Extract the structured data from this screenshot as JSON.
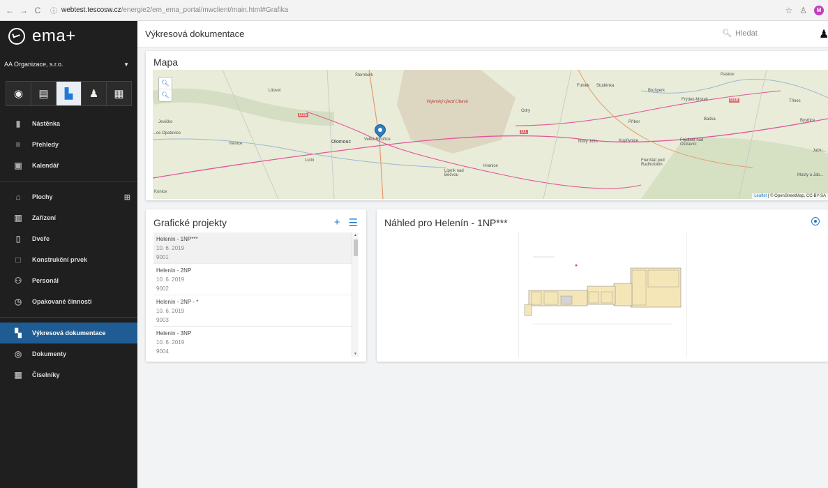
{
  "browser": {
    "url_host": "webtest.tescosw.cz",
    "url_path": "/energie2/em_ema_portal/mwclient/main.html#Grafika",
    "profile_initial": "M"
  },
  "sidebar": {
    "logo": "ema+",
    "org_name": "AA Organizace, s.r.o.",
    "items": [
      {
        "label": "Nástěnka",
        "icon": "bar-chart-icon"
      },
      {
        "label": "Přehledy",
        "icon": "list-icon"
      },
      {
        "label": "Kalendář",
        "icon": "calendar-icon"
      },
      {
        "label": "Plochy",
        "icon": "building-icon"
      },
      {
        "label": "Zařízení",
        "icon": "device-icon"
      },
      {
        "label": "Dveře",
        "icon": "door-icon"
      },
      {
        "label": "Konstrukční prvek",
        "icon": "square-icon"
      },
      {
        "label": "Personál",
        "icon": "people-icon"
      },
      {
        "label": "Opakované činnosti",
        "icon": "timer-icon"
      },
      {
        "label": "Výkresová dokumentace",
        "icon": "map-icon"
      },
      {
        "label": "Dokumenty",
        "icon": "eye-icon"
      },
      {
        "label": "Číselníky",
        "icon": "grid-icon"
      }
    ]
  },
  "header": {
    "title": "Výkresová dokumentace",
    "search_placeholder": "Hledat"
  },
  "map": {
    "title": "Mapa",
    "attribution_link": "Leaflet",
    "attribution_text": " | © OpenStreetMap, CC-BY-SA",
    "labels": {
      "sternberk": "Šternberk",
      "litovel": "Litovel",
      "vojensky": "Vojenský újezd Libavá",
      "olomouc": "Olomouc",
      "velka_bystrice": "Velká Bystřice",
      "kenice": "Kenice",
      "lutin": "Lutín",
      "lipnik": "Lipník nad Bečvou",
      "hranice": "Hranice",
      "odry": "Odry",
      "fulnek": "Fulnek",
      "studenka": "Studénka",
      "brusperk": "Brušperk",
      "frydek": "Frýdek-Místek",
      "novy_jicin": "Nový Jičín",
      "koprivnice": "Kopřivnice",
      "frenstat": "Frenštát pod Radhoštěm",
      "frydlant": "Frýdlant nad Ostravicí",
      "baska": "Baška",
      "pribor": "Příbor",
      "trinec": "Třinec",
      "bystrice": "Bystřice",
      "jablunkov": "Jablu...",
      "mosty": "Mosty u Jab...",
      "prostejov": "...ce Opatovice",
      "jevicko": "Jevíčko",
      "konice": "Konice",
      "paskov": "Paskov",
      "d35": "D35",
      "d1": "D1",
      "d48": "D48"
    }
  },
  "projects": {
    "title": "Grafické projekty",
    "items": [
      {
        "name": "Helenín - 1NP***",
        "date": "10. 6. 2019",
        "code": "9001"
      },
      {
        "name": "Helenín - 2NP",
        "date": "10. 6. 2019",
        "code": "9002"
      },
      {
        "name": "Helenín - 2NP - *",
        "date": "10. 6. 2019",
        "code": "9003"
      },
      {
        "name": "Helenín - 3NP",
        "date": "10. 6. 2019",
        "code": "9004"
      }
    ]
  },
  "preview": {
    "title": "Náhled pro Helenín - 1NP***"
  },
  "colors": {
    "accent": "#1f7ad6",
    "sidebar_bg": "#1f1f1f",
    "active_item": "#1f5c93",
    "selection_bar": "#6aa341"
  }
}
